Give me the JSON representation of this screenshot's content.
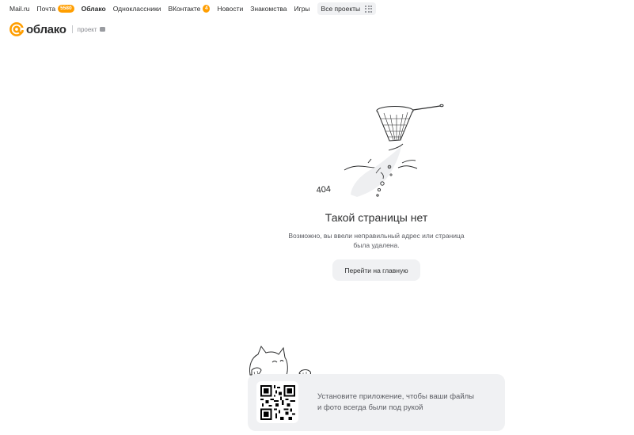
{
  "topnav": {
    "items": [
      {
        "label": "Mail.ru",
        "badge": ""
      },
      {
        "label": "Почта",
        "badge": "5580"
      },
      {
        "label": "Облако",
        "badge": "",
        "active": true
      },
      {
        "label": "Одноклассники",
        "badge": ""
      },
      {
        "label": "ВКонтакте",
        "badge": "4"
      },
      {
        "label": "Новости",
        "badge": ""
      },
      {
        "label": "Знакомства",
        "badge": ""
      },
      {
        "label": "Игры",
        "badge": ""
      }
    ],
    "all_projects": "Все проекты"
  },
  "logo": {
    "name": "облако",
    "project_label": "проект"
  },
  "error": {
    "code": "404",
    "title": "Такой страницы нет",
    "description": "Возможно, вы ввели неправильный адрес или страница была удалена.",
    "home_button": "Перейти на главную"
  },
  "promo": {
    "text": "Установите приложение, чтобы ваши файлы и фото всегда были под рукой"
  },
  "colors": {
    "accent": "#ff9e00",
    "button_bg": "#f0f1f3",
    "text": "#2c2d2e"
  }
}
